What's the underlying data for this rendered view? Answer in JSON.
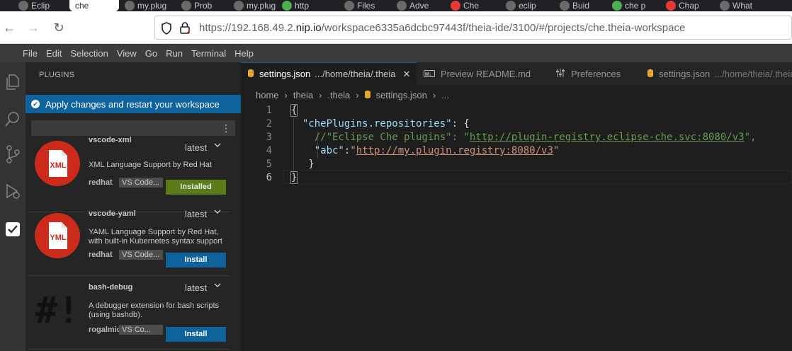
{
  "browser": {
    "tabs": [
      {
        "label": "Eclip",
        "color": "#6a6a6a"
      },
      {
        "label": "che",
        "color": "#ffffff",
        "active": true
      },
      {
        "label": "my.plug",
        "color": "#6a6a6a"
      },
      {
        "label": "Prob",
        "color": "#6a6a6a"
      },
      {
        "label": "my.plug",
        "color": "#6a6a6a"
      },
      {
        "label": "http",
        "color": "#4caf50"
      },
      {
        "label": "Files",
        "color": "#6a6a6a"
      },
      {
        "label": "Adve",
        "color": "#6a6a6a"
      },
      {
        "label": "Che",
        "color": "#e53935"
      },
      {
        "label": "eclip",
        "color": "#6a6a6a"
      },
      {
        "label": "Buid",
        "color": "#6a6a6a"
      },
      {
        "label": "che p",
        "color": "#4caf50"
      },
      {
        "label": "Chap",
        "color": "#e53935"
      },
      {
        "label": "What",
        "color": "#6a6a6a"
      }
    ],
    "url_prefix": "https://192.168.49.2.",
    "url_domain": "nip.io",
    "url_suffix": "/workspace6335a6dcbc97443f/theia-ide/3100/#/projects/che.theia-workspace"
  },
  "menubar": [
    "File",
    "Edit",
    "Selection",
    "View",
    "Go",
    "Run",
    "Terminal",
    "Help"
  ],
  "activity": [
    "explorer-icon",
    "search-icon",
    "source-control-icon",
    "debug-icon",
    "plugins-icon"
  ],
  "sidebar": {
    "title": "PLUGINS",
    "banner": "Apply changes and restart your workspace",
    "search_menu": "⋮",
    "plugins": [
      {
        "name": "vscode-xml",
        "version": "latest",
        "desc": "XML Language Support by Red Hat",
        "publisher": "redhat",
        "tag": "VS Code...",
        "button": "Installed",
        "logo": "XML"
      },
      {
        "name": "vscode-yaml",
        "version": "latest",
        "desc": "YAML Language Support by Red Hat, with built-in Kubernetes syntax support",
        "publisher": "redhat",
        "tag": "VS Code...",
        "button": "Install",
        "logo": "YML"
      },
      {
        "name": "bash-debug",
        "version": "latest",
        "desc": "A debugger extension for bash scripts (using bashdb).",
        "publisher": "rogalmic",
        "tag": "VS Co...",
        "button": "Install",
        "logo": "#!"
      }
    ]
  },
  "editor": {
    "tabs": [
      {
        "label": "settings.json",
        "sub": ".../home/theia/.theia",
        "active": true,
        "icon": "database-icon"
      },
      {
        "label": "Preview README.md",
        "sub": "",
        "active": false,
        "icon": "markdown-icon"
      },
      {
        "label": "Preferences",
        "sub": "",
        "active": false,
        "icon": "preferences-icon"
      },
      {
        "label": "settings.json",
        "sub": ".../home/theia/.theia",
        "active": false,
        "icon": "database-icon"
      }
    ],
    "close_glyph": "✕",
    "breadcrumb": [
      "home",
      "theia",
      ".theia",
      "settings.json",
      "..."
    ],
    "line_numbers": [
      "1",
      "2",
      "3",
      "4",
      "5",
      "6"
    ],
    "code": {
      "l1": "{",
      "l2_key": "\"chePlugins.repositories\"",
      "l2_rest": ": {",
      "l3_comment": "//\"Eclipse Che plugins\": \"",
      "l3_url": "http://plugin-registry.eclipse-che.svc:8080/v3",
      "l3_end": "\",",
      "l4_key": "\"abc\"",
      "l4_colon": ":",
      "l4_q1": "\"",
      "l4_url": "http://my.plugin.registry:8080/v3",
      "l4_q2": "\"",
      "l5": "}",
      "l6": "}"
    }
  }
}
